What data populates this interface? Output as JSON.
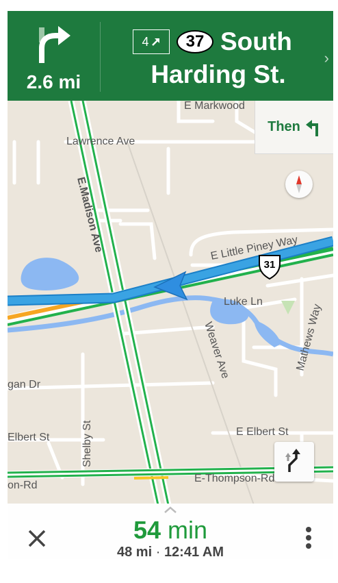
{
  "header": {
    "distance": "2.6 mi",
    "exit_number": "4",
    "route_shield": "37",
    "street_line1": "South",
    "street_line2": "Harding St.",
    "turn_icon": "turn-right-arrow-icon"
  },
  "then": {
    "label": "Then",
    "icon": "turn-left-arrow-icon"
  },
  "map": {
    "labels": {
      "markwood": "E Markwood",
      "lawrence": "Lawrence Ave",
      "madison": "E.Madison Ave",
      "little_piney": "E Little Piney Way",
      "us31_shield": "31",
      "luke": "Luke Ln",
      "weaver": "Weaver Ave",
      "mathews": "Mathews Way",
      "gan": "gan Dr",
      "elbert_left": "Elbert St",
      "shelby": "Shelby St",
      "elbert_right": "E Elbert St",
      "on_rd": "on-Rd",
      "thompson": "E-Thompson-Rd"
    },
    "colors": {
      "land": "#ece6dc",
      "water": "#8cb8f2",
      "route": "#3aa3e3",
      "traffic_green": "#22b14c",
      "traffic_orange": "#f6a623",
      "header": "#1e7a3e"
    }
  },
  "controls": {
    "compass_icon": "compass-icon",
    "route_overview_icon": "route-overview-icon"
  },
  "eta": {
    "minutes": "54",
    "unit": "min",
    "distance": "48 mi",
    "separator": "·",
    "arrival": "12:41 AM"
  },
  "bottom": {
    "close_icon": "close-icon",
    "more_icon": "more-vert-icon"
  }
}
